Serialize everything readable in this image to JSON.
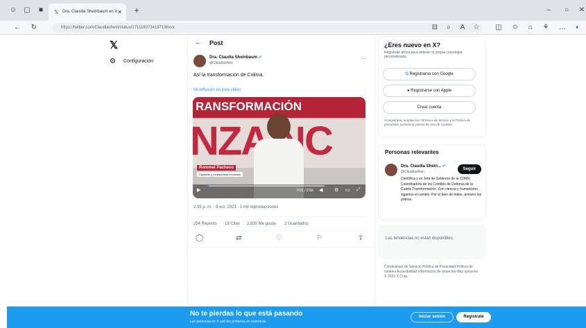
{
  "browser": {
    "tab_title": "Dra. Claudia Sheinbaum en X",
    "url": "https://twitter.com/Claudiashein/status/1711190734197196xxx",
    "icons": [
      "back-icon",
      "refresh-icon",
      "home-icon",
      "star-icon",
      "more-icon",
      "minimize-icon",
      "maximize-icon",
      "close-icon"
    ]
  },
  "nav": {
    "logo": "𝕏",
    "settings_label": "Configuración"
  },
  "post": {
    "header": "Post",
    "author_name": "Dra. Claudia Sheinbaum",
    "author_handle": "@Claudiashein",
    "text": "Así la transformación de Colima.",
    "link_text": "Mi reflexión en este video",
    "video": {
      "headline_1": "RANSFORMACIÓN",
      "headline_2": "NZA NC",
      "lower_third_name": "Rommel Pacheco",
      "lower_third_title": "Diputado y exdeportista mexicano",
      "time": "0:01 / 0:56"
    },
    "timestamp": "2:35 p. m. · 8 oct. 2023",
    "views": "1 mil reproducciones",
    "stats": {
      "reposts": "254 Reposts",
      "quotes": "19 Citas",
      "likes": "2,830 Me gusta",
      "bookmarks": "2 Guardados"
    }
  },
  "signup": {
    "title": "¿Eres nuevo en X?",
    "subtitle": "Regístrate ahora para obtener tu propia cronología personalizada.",
    "google": "Registrarse con Google",
    "apple": "Registrarse con Apple",
    "create": "Crear cuenta",
    "terms": "Al registrarte, aceptas los Términos de servicio y la Política de privacidad, incluida la política de Uso de Cookies."
  },
  "relevant": {
    "title": "Personas relevantes",
    "name": "Dra. Claudia Shein...",
    "handle": "@Claudiashein",
    "follow": "Seguir",
    "bio": "Científica y ex Jefa de Gobierno de la CDMX. Coordinadora de los Comités de Defensa de la Cuarta Transformación. Con ciencia y humanismo, sigamos el cambio. Por el bien de todos, primero los pobres."
  },
  "trends_box": "Las tendencias no están disponibles.",
  "footer_links": "Condiciones de Servicio   Política de Privacidad   Política de cookies   Accesibilidad   Información de anuncios   Más opciones   © 2023 X Corp.",
  "bottom": {
    "headline": "No te pierdas lo que está pasando",
    "sub": "Las personas en X son las primeras en enterarse.",
    "login": "Iniciar sesión",
    "register": "Regístrate"
  }
}
